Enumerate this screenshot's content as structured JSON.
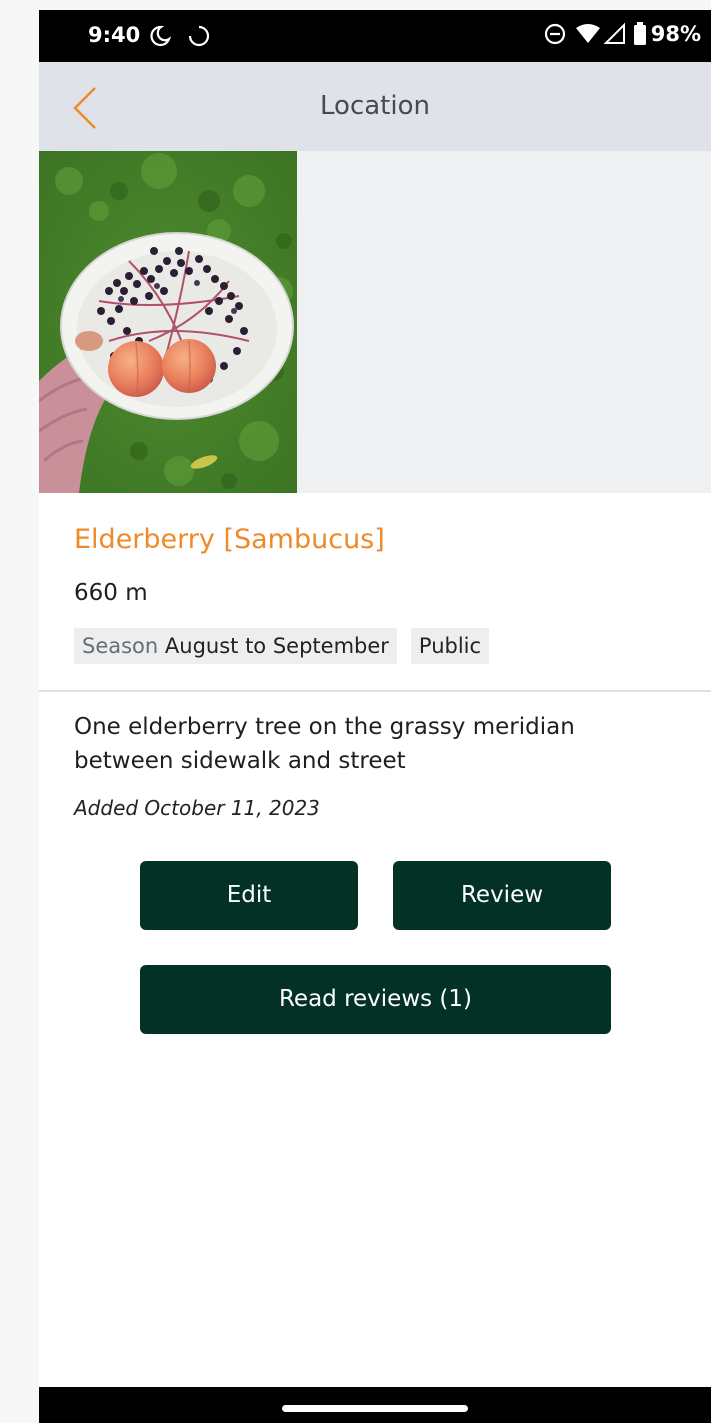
{
  "status_bar": {
    "time": "9:40",
    "battery": "98%"
  },
  "header": {
    "title": "Location",
    "accent_color": "#ef8a2a",
    "background_color": "#dfe2e8"
  },
  "location": {
    "name": "Elderberry [Sambucus]",
    "distance": "660 m",
    "season_label": "Season",
    "season_value": "August to September",
    "access": "Public",
    "description": "One elderberry tree on the grassy meridian between sidewalk and street",
    "added": "Added October 11, 2023"
  },
  "actions": {
    "edit_label": "Edit",
    "review_label": "Review",
    "read_reviews_label": "Read reviews (1)",
    "button_color": "#043126"
  }
}
